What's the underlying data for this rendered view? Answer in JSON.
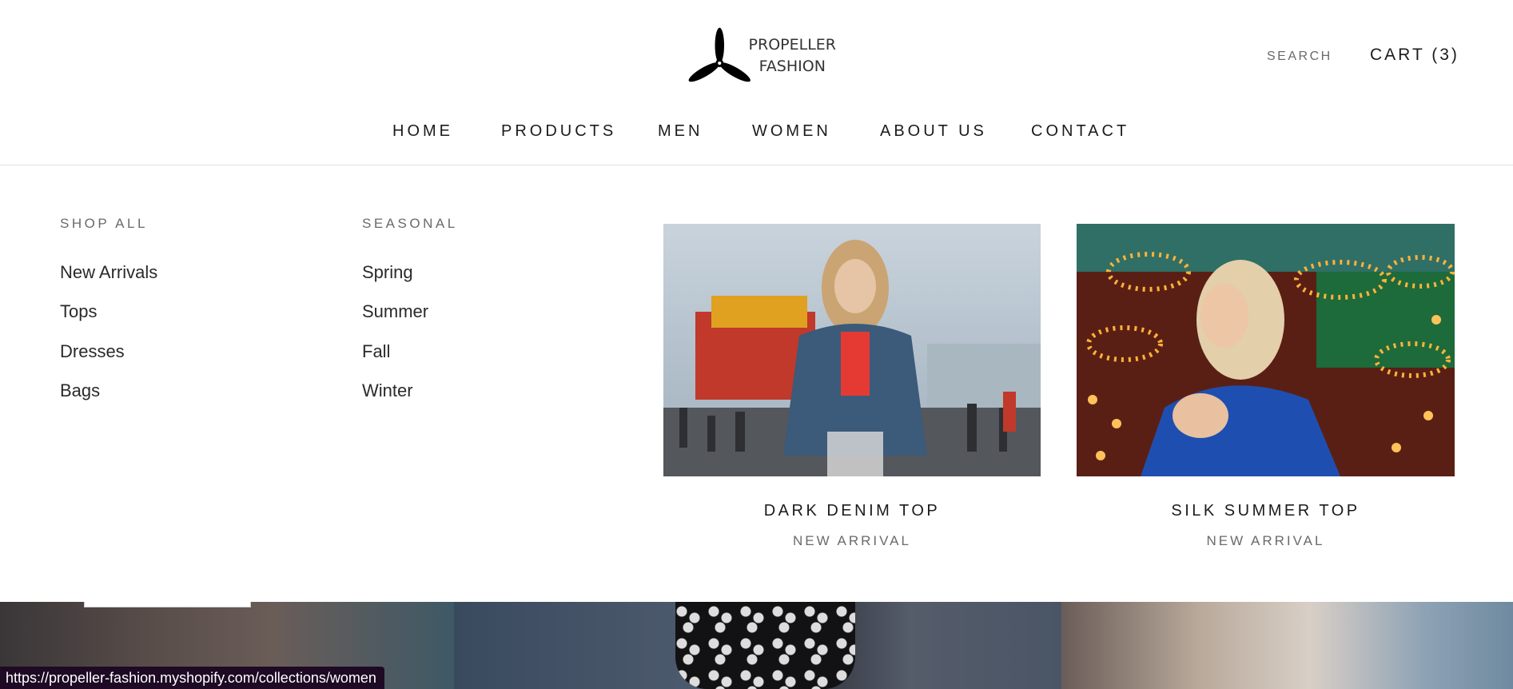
{
  "logo": {
    "line1": "PROPELLER",
    "line2": "FASHION",
    "icon": "propeller-icon"
  },
  "header": {
    "search_label": "SEARCH",
    "cart_label": "CART (3)"
  },
  "nav": {
    "items": [
      {
        "label": "HOME",
        "active": true
      },
      {
        "label": "PRODUCTS",
        "active": false
      },
      {
        "label": "MEN",
        "active": false
      },
      {
        "label": "WOMEN",
        "active": true
      },
      {
        "label": "ABOUT US",
        "active": false
      },
      {
        "label": "CONTACT",
        "active": false
      }
    ]
  },
  "mega_menu": {
    "shop_all": {
      "title": "SHOP ALL",
      "links": [
        "New Arrivals",
        "Tops",
        "Dresses",
        "Bags"
      ]
    },
    "seasonal": {
      "title": "SEASONAL",
      "links": [
        "Spring",
        "Summer",
        "Fall",
        "Winter"
      ]
    },
    "promos": [
      {
        "title": "DARK DENIM TOP",
        "subtitle": "NEW ARRIVAL"
      },
      {
        "title": "SILK SUMMER TOP",
        "subtitle": "NEW ARRIVAL"
      }
    ]
  },
  "status_bar": {
    "url": "https://propeller-fashion.myshopify.com/collections/women"
  },
  "colors": {
    "text": "#1c1b1b",
    "muted": "#6a6a6a",
    "status_bg": "#1e0a24"
  }
}
